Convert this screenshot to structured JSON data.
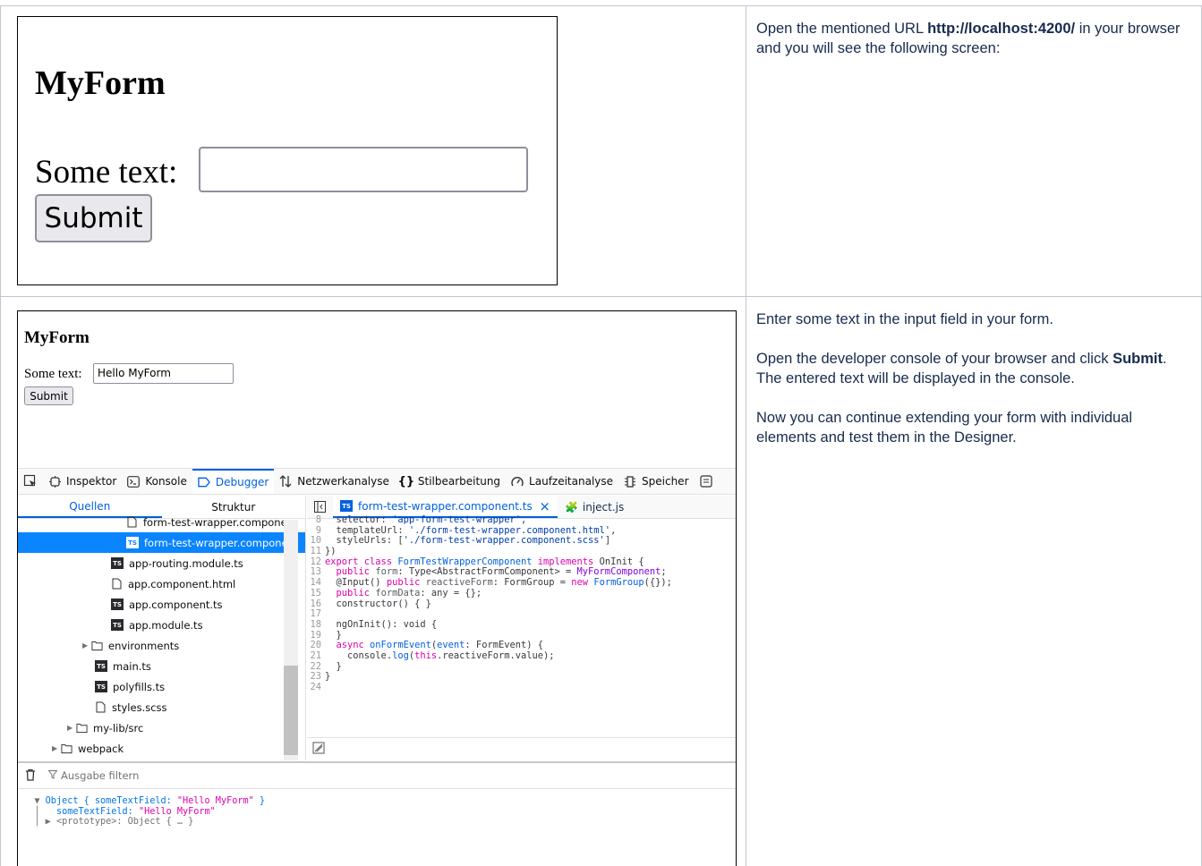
{
  "row1": {
    "form": {
      "title": "MyForm",
      "label": "Some text:",
      "input_value": "",
      "submit": "Submit"
    },
    "text_before": "Open the mentioned URL ",
    "url": "http://localhost:4200/",
    "text_after": " in your browser and you will see the following screen:"
  },
  "row2": {
    "form": {
      "title": "MyForm",
      "label": "Some text:",
      "input_value": "Hello MyForm",
      "submit": "Submit"
    },
    "p1": "Enter some text in the input field in your form.",
    "p2_before": "Open the developer console of your browser and click ",
    "p2_bold": "Submit",
    "p2_after": ". The entered text will be displayed in the console.",
    "p3": "Now you can continue extending your form with individual elements and test them in the Designer."
  },
  "devtools": {
    "tabs": [
      {
        "label": "Inspektor",
        "icon": "inspector-icon"
      },
      {
        "label": "Konsole",
        "icon": "console-icon"
      },
      {
        "label": "Debugger",
        "icon": "debugger-icon",
        "active": true
      },
      {
        "label": "Netzwerkanalyse",
        "icon": "network-icon"
      },
      {
        "label": "Stilbearbeitung",
        "icon": "style-editor-icon"
      },
      {
        "label": "Laufzeitanalyse",
        "icon": "performance-icon"
      },
      {
        "label": "Speicher",
        "icon": "memory-icon"
      }
    ],
    "source_tabs": {
      "sources": "Quellen",
      "outline": "Struktur"
    },
    "tree": [
      {
        "label": "form-test-wrapper.componen",
        "type": "file"
      },
      {
        "label": "form-test-wrapper.componen",
        "type": "ts",
        "selected": true
      },
      {
        "label": "app-routing.module.ts",
        "type": "ts"
      },
      {
        "label": "app.component.html",
        "type": "file"
      },
      {
        "label": "app.component.ts",
        "type": "ts"
      },
      {
        "label": "app.module.ts",
        "type": "ts"
      },
      {
        "label": "environments",
        "type": "folder"
      },
      {
        "label": "main.ts",
        "type": "ts"
      },
      {
        "label": "polyfills.ts",
        "type": "ts"
      },
      {
        "label": "styles.scss",
        "type": "file"
      },
      {
        "label": "my-lib/src",
        "type": "folder"
      },
      {
        "label": "webpack",
        "type": "folder"
      }
    ],
    "editor_tabs": {
      "active": "form-test-wrapper.component.ts",
      "close": "×",
      "other": "inject.js"
    },
    "code_lines": [
      "8",
      "9",
      "10",
      "11",
      "12",
      "13",
      "14",
      "15",
      "16",
      "17",
      "18",
      "19",
      "20",
      "21",
      "22",
      "23",
      "24"
    ],
    "console": {
      "filter_placeholder": "Ausgabe filtern",
      "line1_key": "Object { someTextField: ",
      "line1_val": "\"Hello MyForm\"",
      "line1_end": " }",
      "line2_key": "someTextField: ",
      "line2_val": "\"Hello MyForm\"",
      "line3": "<prototype>: Object { … }"
    }
  }
}
